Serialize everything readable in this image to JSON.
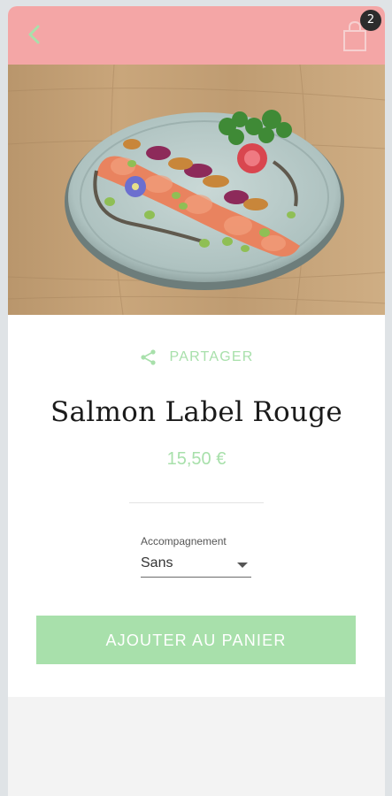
{
  "header": {
    "back_icon": "chevron-left-icon",
    "cart_icon": "shopping-bag-icon",
    "cart_count": "2",
    "color": "#f4a6a6"
  },
  "product": {
    "image_alt": "Salmon Label Rouge",
    "share_label": "PARTAGER",
    "title": "Salmon Label Rouge",
    "price": "15,50 €"
  },
  "options": {
    "label": "Accompagnement",
    "selected": "Sans"
  },
  "cta": {
    "label": "AJOUTER AU PANIER",
    "color": "#a8e0ab"
  }
}
